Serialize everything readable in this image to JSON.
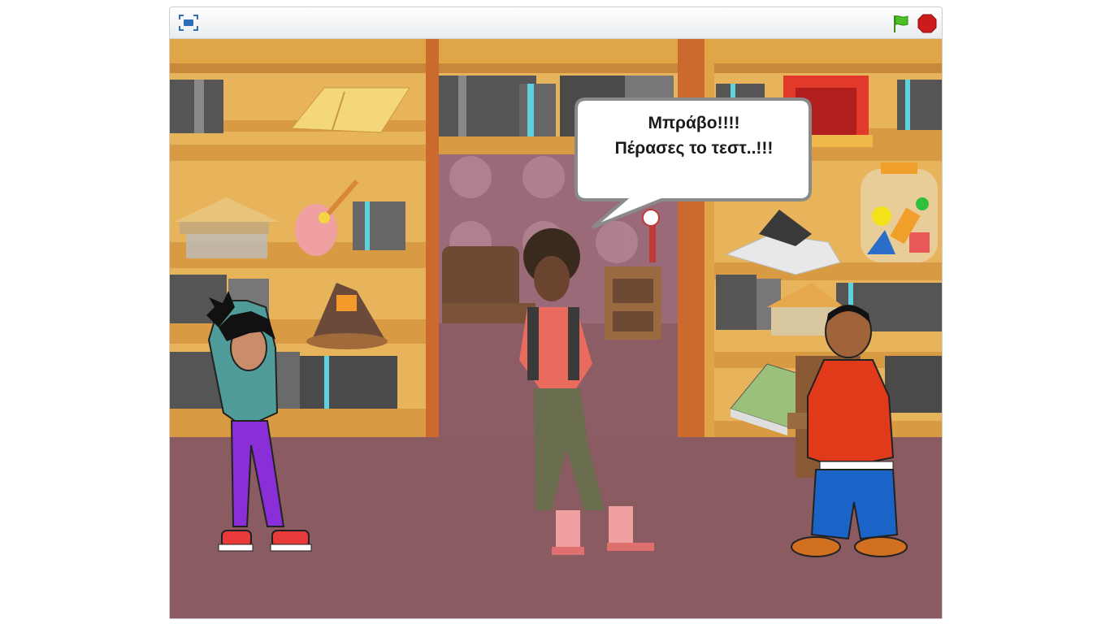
{
  "toolbar": {
    "fullscreen_icon": "fullscreen-icon",
    "flag_icon": "green-flag-icon",
    "stop_icon": "stop-icon",
    "flag_color": "#4cbf25",
    "stop_color": "#cc1b1b"
  },
  "stage": {
    "backdrop": "library",
    "speech_bubble": {
      "line1": "Μπράβο!!!!",
      "line2": "Πέρασες το τεστ..!!!"
    },
    "sprites": [
      "girl-sprite",
      "teacher-sprite",
      "boy-sprite"
    ]
  }
}
